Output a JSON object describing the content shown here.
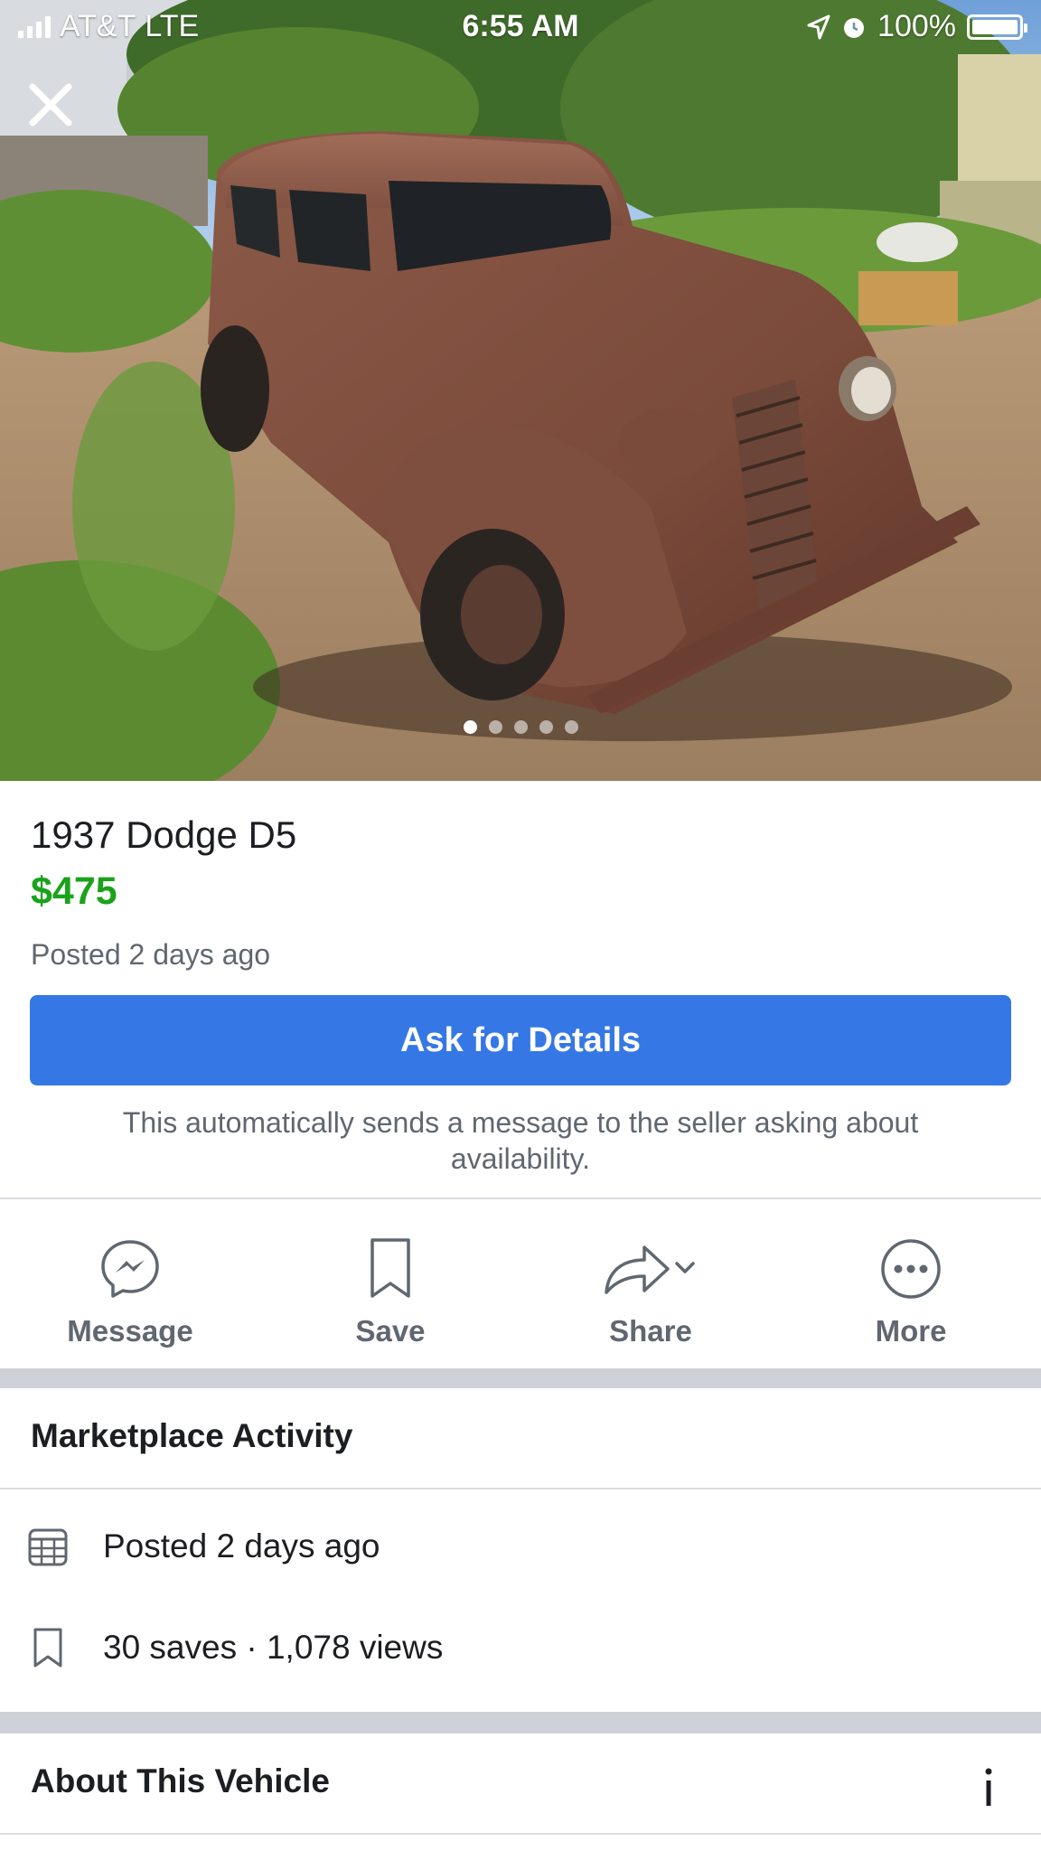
{
  "status_bar": {
    "carrier": "AT&T",
    "network": "LTE",
    "time": "6:55 AM",
    "battery": "100%",
    "battery_level": 1.0
  },
  "hero": {
    "photo_count": 5,
    "active_index": 0
  },
  "listing": {
    "title": "1937 Dodge D5",
    "price": "$475",
    "posted": "Posted 2 days ago",
    "price_color": "#1aa31a"
  },
  "ask_button": {
    "label": "Ask for Details",
    "note": "This automatically sends a message to the seller asking about availability.",
    "color": "#3578e5"
  },
  "actions": [
    {
      "label": "Message",
      "icon": "messenger-icon"
    },
    {
      "label": "Save",
      "icon": "bookmark-icon"
    },
    {
      "label": "Share",
      "icon": "share-icon"
    },
    {
      "label": "More",
      "icon": "more-icon"
    }
  ],
  "activity": {
    "title": "Marketplace Activity",
    "posted": "Posted 2 days ago",
    "saves_views": "30 saves · 1,078 views"
  },
  "about": {
    "title": "About This Vehicle",
    "info_glyph": "i"
  }
}
